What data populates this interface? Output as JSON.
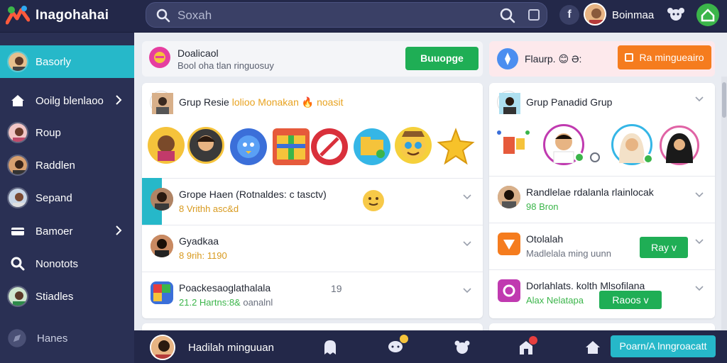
{
  "app": {
    "title": "Inagohahai"
  },
  "search": {
    "placeholder": "Soxah"
  },
  "header": {
    "user_name": "Boinmaa"
  },
  "sidebar": {
    "items": [
      {
        "label": "Basorly",
        "active": true
      },
      {
        "label": "Ooilg blenlaoo",
        "has_chevron": true
      },
      {
        "label": "Roup"
      },
      {
        "label": "Raddlen"
      },
      {
        "label": "Sepand"
      },
      {
        "label": "Bamoer",
        "has_chevron": true
      },
      {
        "label": "Nonotots"
      },
      {
        "label": "Stiadles"
      },
      {
        "label": "Hanes"
      }
    ]
  },
  "banner_left": {
    "title": "Doalicaol",
    "subtitle": "Bool oha tlan ringuosuy",
    "button": "Buuopge"
  },
  "banner_right": {
    "title": "Flaurp.",
    "emoji_text": "😊 Ə:",
    "button": "Ra mingueairo"
  },
  "group_left": {
    "header_prefix": "Grup Resie",
    "header_highlight": "lolioo Monakan",
    "header_suffix": "noasit",
    "rows": [
      {
        "title": "Grope Haen (Rotnaldes: c tasctv)",
        "subtitle": "8 Vrithh asc&d",
        "sub_color": "#d89a1e"
      },
      {
        "title": "Gyadkaa",
        "subtitle": "8 9rih: 1190",
        "sub_color": "#d89a1e"
      },
      {
        "title": "Poackesaoglathalala",
        "subtitle_green": "21.2 Hartns:8&",
        "subtitle_gray": "oanalnl",
        "sub_color": "#3bb54a",
        "count": "19"
      }
    ]
  },
  "group_right": {
    "header": "Grup Panadid  Grup",
    "rows": [
      {
        "title": "Randlelae rdalanla rlainlocak",
        "subtitle": "98 Bron",
        "sub_color": "#3bb54a"
      },
      {
        "title": "Otolalah",
        "subtitle": "Madlelala ming uunn",
        "button": "Ray v"
      },
      {
        "title": "Dorlahlats. kolth Mlsofilana",
        "subtitle": "Alax Nelatapa",
        "button": "Raoos v"
      }
    ]
  },
  "bottombar": {
    "label": "Hadilah minguuan",
    "button": "Poarn/A lnngroacatt"
  },
  "colors": {
    "accent": "#26b8c9",
    "green": "#1fae55",
    "orange": "#f57c1e",
    "nav_bg": "#2a3054"
  }
}
